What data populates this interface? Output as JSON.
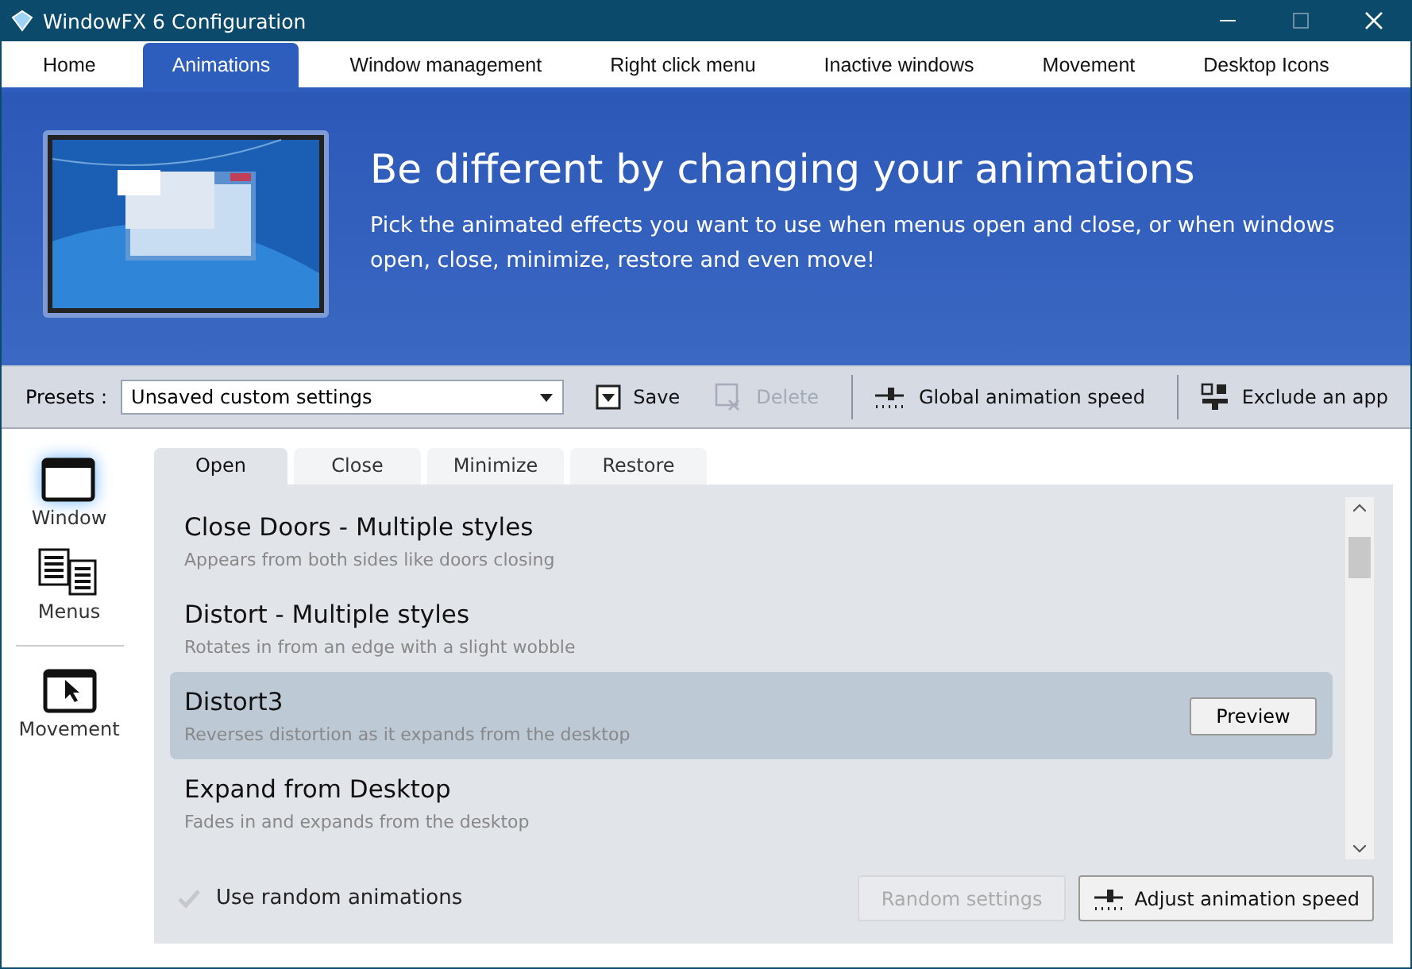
{
  "window": {
    "title": "WindowFX 6 Configuration"
  },
  "nav_tabs": [
    {
      "label": "Home",
      "selected": false
    },
    {
      "label": "Animations",
      "selected": true
    },
    {
      "label": "Window management",
      "selected": false
    },
    {
      "label": "Right click menu",
      "selected": false
    },
    {
      "label": "Inactive windows",
      "selected": false
    },
    {
      "label": "Movement",
      "selected": false
    },
    {
      "label": "Desktop Icons",
      "selected": false
    }
  ],
  "banner": {
    "heading": "Be different by changing your animations",
    "text": "Pick the animated effects you want to use when menus open and close, or when windows open, close, minimize, restore and even move!"
  },
  "toolbar": {
    "presets_label": "Presets :",
    "presets_value": "Unsaved custom settings",
    "buttons": [
      {
        "kind": "save",
        "label": "Save",
        "disabled": false
      },
      {
        "kind": "delete",
        "label": "Delete",
        "disabled": true
      },
      {
        "kind": "speed",
        "label": "Global animation speed",
        "disabled": false
      },
      {
        "kind": "exclude",
        "label": "Exclude an app",
        "disabled": false
      }
    ]
  },
  "sidebar": {
    "groups": [
      [
        {
          "kind": "window",
          "label": "Window",
          "selected": true
        },
        {
          "kind": "menus",
          "label": "Menus",
          "selected": false
        }
      ],
      [
        {
          "kind": "movement",
          "label": "Movement",
          "selected": false
        }
      ]
    ]
  },
  "effect_tabs": [
    {
      "label": "Open",
      "selected": true
    },
    {
      "label": "Close",
      "selected": false
    },
    {
      "label": "Minimize",
      "selected": false
    },
    {
      "label": "Restore",
      "selected": false
    }
  ],
  "effects": [
    {
      "name": "Close Doors - Multiple styles",
      "description": "Appears from both sides like doors closing",
      "selected": false
    },
    {
      "name": "Distort - Multiple styles",
      "description": "Rotates in from an edge with a slight wobble",
      "selected": false
    },
    {
      "name": "Distort3",
      "description": "Reverses distortion as it expands from the desktop",
      "selected": true
    },
    {
      "name": "Expand from Desktop",
      "description": "Fades in and expands from the desktop",
      "selected": false
    }
  ],
  "preview_button": "Preview",
  "random_animations": {
    "label": "Use random animations",
    "checked": true
  },
  "bottom_buttons": [
    {
      "kind": "plain",
      "label": "Random settings",
      "disabled": true
    },
    {
      "kind": "speed",
      "label": "Adjust animation speed",
      "disabled": false
    }
  ]
}
